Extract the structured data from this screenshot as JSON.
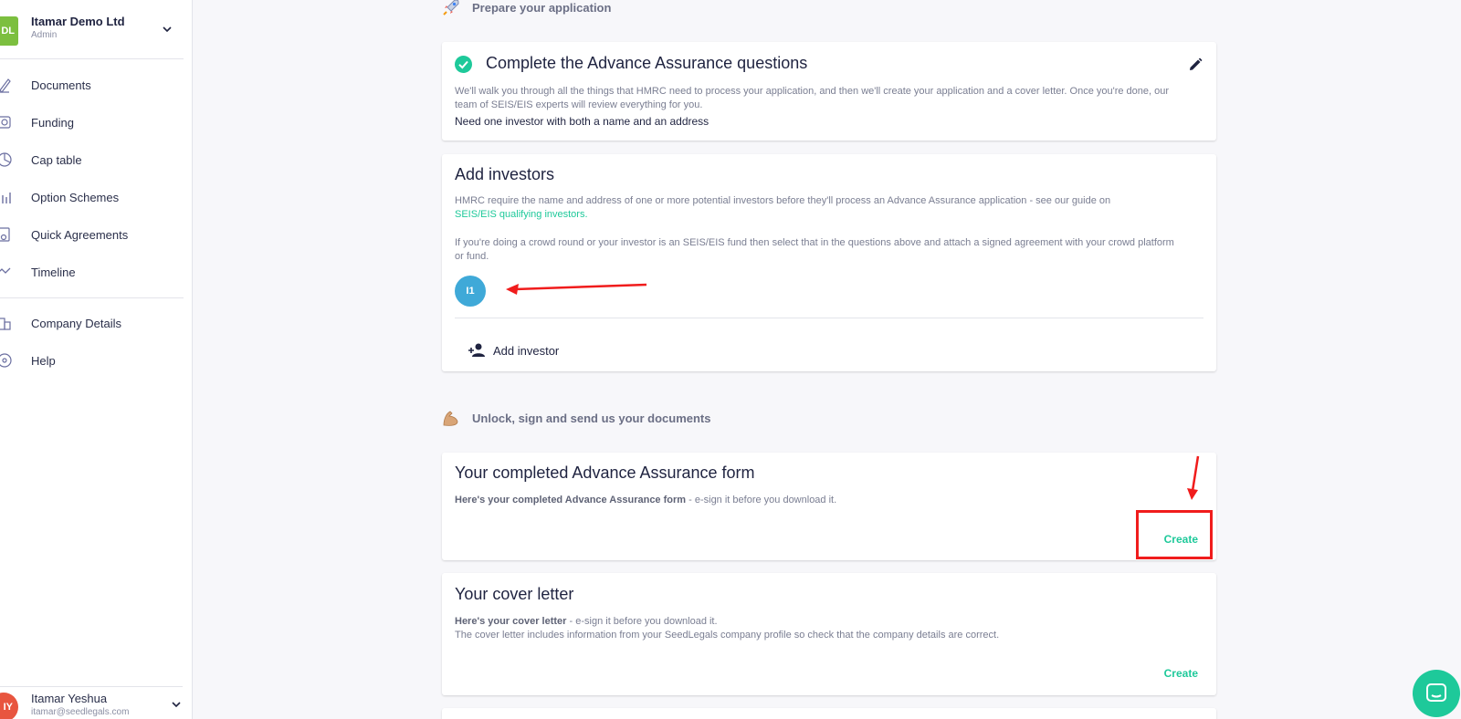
{
  "sidebar": {
    "company": {
      "badge": "DL",
      "name": "Itamar Demo Ltd",
      "role": "Admin"
    },
    "items": [
      {
        "label": "Documents",
        "icon": "document-pen-icon"
      },
      {
        "label": "Funding",
        "icon": "funding-icon"
      },
      {
        "label": "Cap table",
        "icon": "cap-table-icon"
      },
      {
        "label": "Option Schemes",
        "icon": "chart-icon"
      },
      {
        "label": "Quick Agreements",
        "icon": "agreement-icon"
      },
      {
        "label": "Timeline",
        "icon": "timeline-icon"
      }
    ],
    "secondary": [
      {
        "label": "Company Details",
        "icon": "building-icon"
      },
      {
        "label": "Help",
        "icon": "help-icon"
      }
    ],
    "user": {
      "initials": "IY",
      "name": "Itamar Yeshua",
      "email": "itamar@seedlegals.com"
    }
  },
  "sections": {
    "prepare": {
      "title": "Prepare your application",
      "icon": "rocket-icon"
    },
    "unlock": {
      "title": "Unlock, sign and send us your documents",
      "icon": "flexed-bicep-icon"
    }
  },
  "questions_card": {
    "title": "Complete the Advance Assurance questions",
    "text": "We'll walk you through all the things that HMRC need to process your application, and then we'll create your application and a cover letter. Once you're done, our team of SEIS/EIS experts will review everything for you.",
    "note": "Need one investor with both a name and an address"
  },
  "investors_card": {
    "title": "Add investors",
    "text1": "HMRC require the name and address of one or more potential investors before they'll process an Advance Assurance application - see our guide on",
    "link": "SEIS/EIS qualifying investors.",
    "text2": "If you're doing a crowd round or your investor is an SEIS/EIS fund then select that in the questions above and attach a signed agreement with your crowd platform or fund.",
    "investor_initials": "I1",
    "add_label": "Add investor"
  },
  "form_card": {
    "title": "Your completed Advance Assurance form",
    "bold": "Here's your completed Advance Assurance form",
    "rest": " - e-sign it before you download it.",
    "create": "Create"
  },
  "cover_card": {
    "title": "Your cover letter",
    "bold": "Here's your cover letter",
    "rest": " - e-sign it before you download it.",
    "line2": "The cover letter includes information from your SeedLegals company profile so check that the company details are correct.",
    "create": "Create"
  },
  "colors": {
    "accent": "#1ec99a",
    "annotation": "#f01c1c",
    "investor_avatar": "#3fa9d8"
  }
}
